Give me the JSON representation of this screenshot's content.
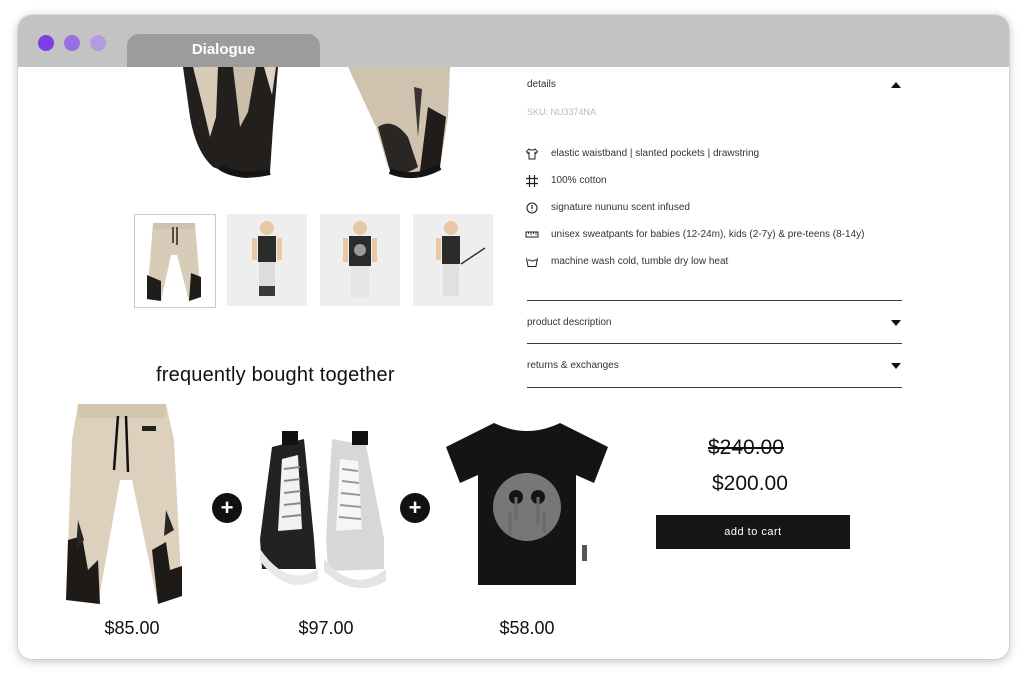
{
  "window": {
    "tab_title": "Dialogue",
    "controls": [
      "close",
      "minimize",
      "maximize"
    ],
    "control_colors": [
      "#7b3fe4",
      "#9a6ee0",
      "#b39be0"
    ]
  },
  "gallery": {
    "thumbnails": [
      {
        "name": "pants-front",
        "selected": true
      },
      {
        "name": "model-front-1",
        "selected": false
      },
      {
        "name": "model-front-2",
        "selected": false
      },
      {
        "name": "model-side",
        "selected": false
      }
    ]
  },
  "details": {
    "heading": "details",
    "sku": "SKU: NU3374NA",
    "features": [
      {
        "icon": "shirt-icon",
        "text": "elastic waistband | slanted pockets | drawstring"
      },
      {
        "icon": "grid-icon",
        "text": "100% cotton"
      },
      {
        "icon": "info-icon",
        "text": "signature nununu scent infused"
      },
      {
        "icon": "ruler-icon",
        "text": "unisex sweatpants for babies (12-24m), kids (2-7y) & pre-teens (8-14y)"
      },
      {
        "icon": "wash-icon",
        "text": "machine wash cold, tumble dry low heat"
      }
    ],
    "accordions": [
      {
        "label": "product description"
      },
      {
        "label": "returns & exchanges"
      }
    ]
  },
  "bundle": {
    "heading": "frequently bought together",
    "products": [
      {
        "name": "bleached sweatpants",
        "price": "$85.00"
      },
      {
        "name": "high-top sneakers",
        "price": "$97.00"
      },
      {
        "name": "smiley t-shirt",
        "price": "$58.00"
      }
    ],
    "old_total": "$240.00",
    "new_total": "$200.00",
    "cta": "add to cart"
  },
  "colors": {
    "titlebar": "#c3c3c3",
    "tab": "#9c9c9c",
    "button": "#151515"
  }
}
